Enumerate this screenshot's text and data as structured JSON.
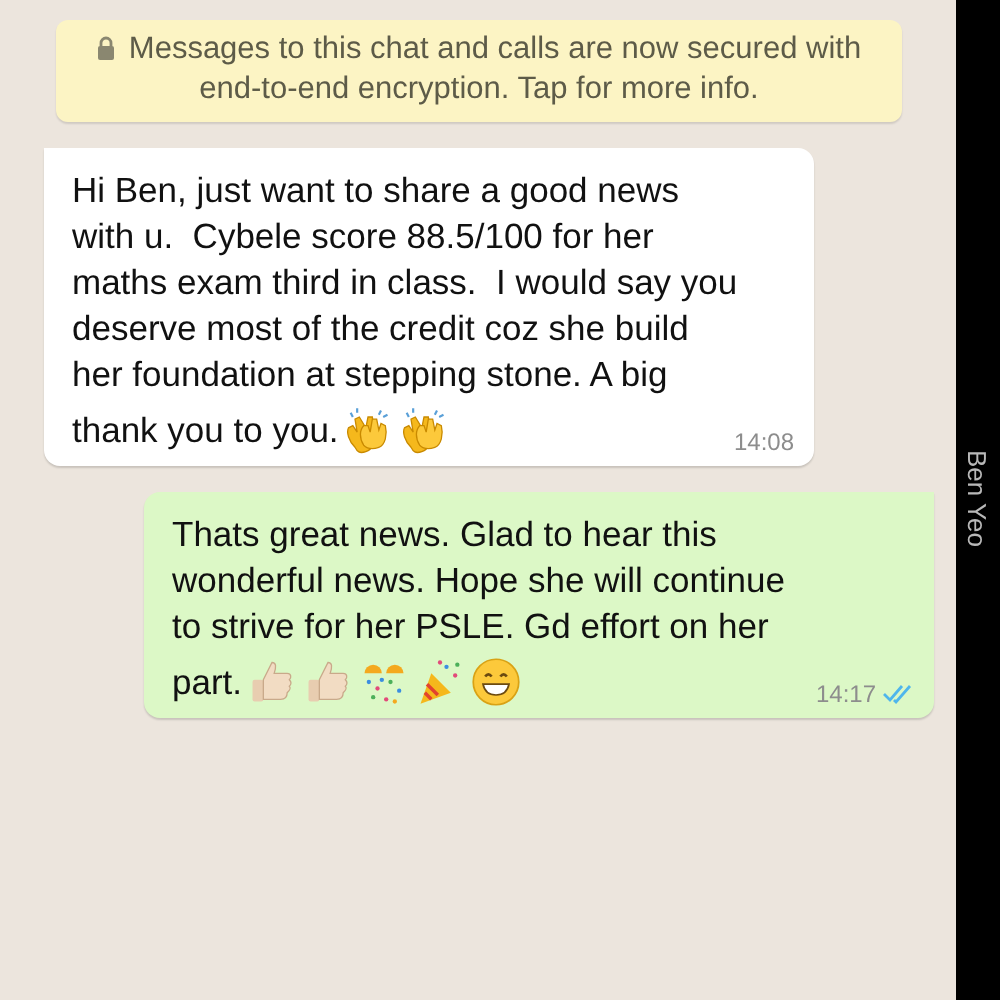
{
  "encryption_notice": {
    "text": "Messages to this chat and calls are now secured with end-to-end encryption. Tap for more info."
  },
  "messages": [
    {
      "kind": "incoming",
      "lines": [
        "Hi Ben, just want to share a good news",
        "with u.  Cybele score 88.5/100 for her",
        "maths exam third in class.  I would say you",
        "deserve most of the credit coz she build",
        "her foundation at stepping stone. A big",
        "thank you to you."
      ],
      "emojis": [
        {
          "kind": "clap"
        },
        {
          "kind": "clap"
        }
      ],
      "time": "14:08"
    },
    {
      "kind": "outgoing",
      "lines": [
        "Thats great news. Glad to hear this",
        "wonderful news. Hope she will continue",
        "to strive for her PSLE. Gd effort on her",
        "part."
      ],
      "emojis": [
        {
          "kind": "thumbs_up"
        },
        {
          "kind": "thumbs_up"
        },
        {
          "kind": "confetti"
        },
        {
          "kind": "popper"
        },
        {
          "kind": "grin"
        }
      ],
      "time": "14:17",
      "read": true
    }
  ],
  "side_label": "Ben Yeo"
}
